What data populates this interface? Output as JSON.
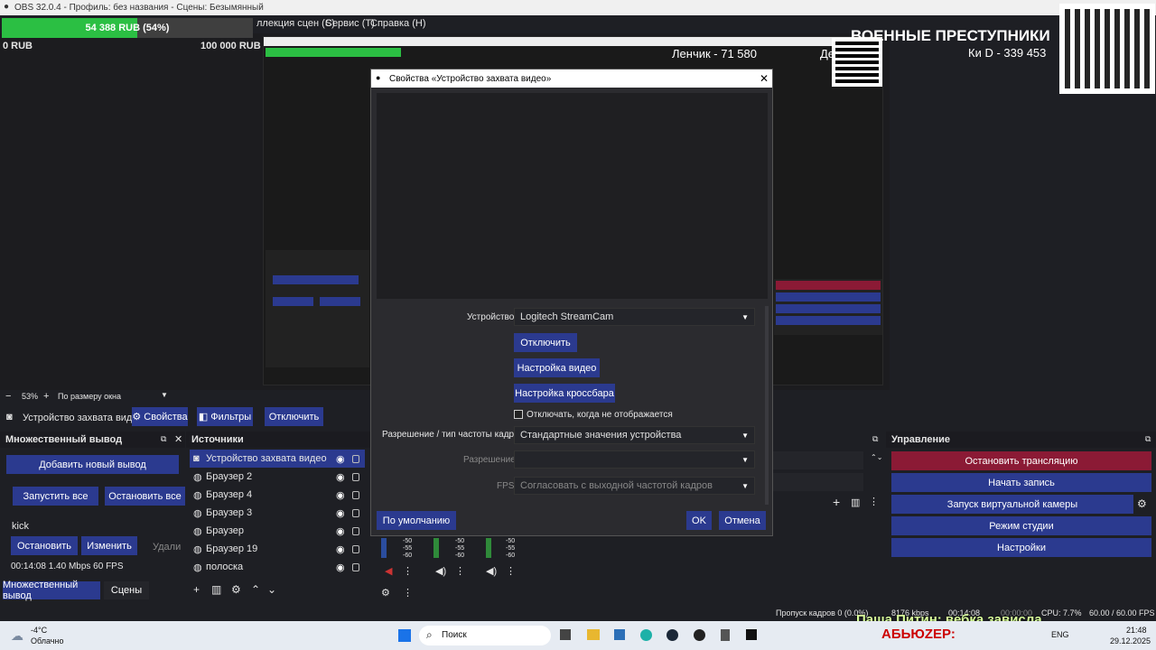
{
  "window": {
    "title": "OBS 32.0.4 - Профиль: без названия - Сцены: Безымянный"
  },
  "donation": {
    "current": "54 388 RUB (54%)",
    "min": "0 RUB",
    "max": "100 000 RUB",
    "progress_percent": 54
  },
  "menu": {
    "items": [
      "ллекция сцен (S)",
      "Сервис (T)",
      "Справка (H)"
    ]
  },
  "overlay": {
    "title": "ВОЕННЫЕ ПРЕСТУПНИКИ",
    "line1": "Ки D - 339 453",
    "line2": "Ленчик - 71 580",
    "line3": "Де... 371"
  },
  "preview_bar": {
    "zoom": "53%",
    "fit": "По размеру окна"
  },
  "context": {
    "source": "Устройство захвата видео",
    "properties": "Свойства",
    "filters": "Фильтры",
    "disable": "Отключить"
  },
  "multi_output": {
    "title": "Множественный вывод",
    "add": "Добавить новый вывод",
    "start_all": "Запустить все",
    "stop_all": "Остановить все",
    "label": "kick",
    "stop": "Остановить",
    "edit": "Изменить",
    "delete": "Удали",
    "stats": "00:14:08  1.40 Mbps  60 FPS"
  },
  "sources": {
    "title": "Источники",
    "items": [
      "Устройство захвата видео",
      "Браузер 2",
      "Браузер 4",
      "Браузер 3",
      "Браузер",
      "Браузер 19",
      "полоска"
    ]
  },
  "dock_tabs": {
    "tab1": "Множественный вывод",
    "tab2": "Сцены"
  },
  "control": {
    "title": "Управление",
    "stop_stream": "Остановить трансляцию",
    "start_record": "Начать запись",
    "virtual_cam": "Запуск виртуальной камеры",
    "studio": "Режим студии",
    "settings": "Настройки"
  },
  "dialog": {
    "title": "Свойства «Устройство захвата видео»",
    "device_label": "Устройство",
    "device_value": "Logitech StreamCam",
    "deactivate": "Отключить",
    "video_config": "Настройка видео",
    "crossbar": "Настройка кроссбара",
    "hide_checkbox": "Отключать, когда не отображается",
    "res_type_label": "Разрешение / тип частоты кадров",
    "res_type_value": "Стандартные значения устройства",
    "resolution_label": "Разрешение",
    "resolution_value": "",
    "fps_label": "FPS",
    "fps_value": "Согласовать с выходной частотой кадров",
    "defaults": "По умолчанию",
    "ok": "OK",
    "cancel": "Отмена"
  },
  "statusbar": {
    "dropped": "Пропуск кадров 0 (0.0%)",
    "kbps": "8176 kbps",
    "stream_time": "00:14:08",
    "rec_time": "00:00:00",
    "cpu": "CPU: 7.7%",
    "fps": "60.00 / 60.00 FPS"
  },
  "chat": {
    "line": "Паша Питин: вебка зависла",
    "brand": "АБЬЮZЕР:"
  },
  "weather": {
    "temp": "-4°C",
    "desc": "Облачно"
  },
  "taskbar": {
    "search": "Поиск",
    "lang": "ENG",
    "time": "21:48",
    "date": "29.12.2025"
  },
  "mixer": {
    "db": [
      "-50",
      "-55",
      "-60"
    ]
  }
}
